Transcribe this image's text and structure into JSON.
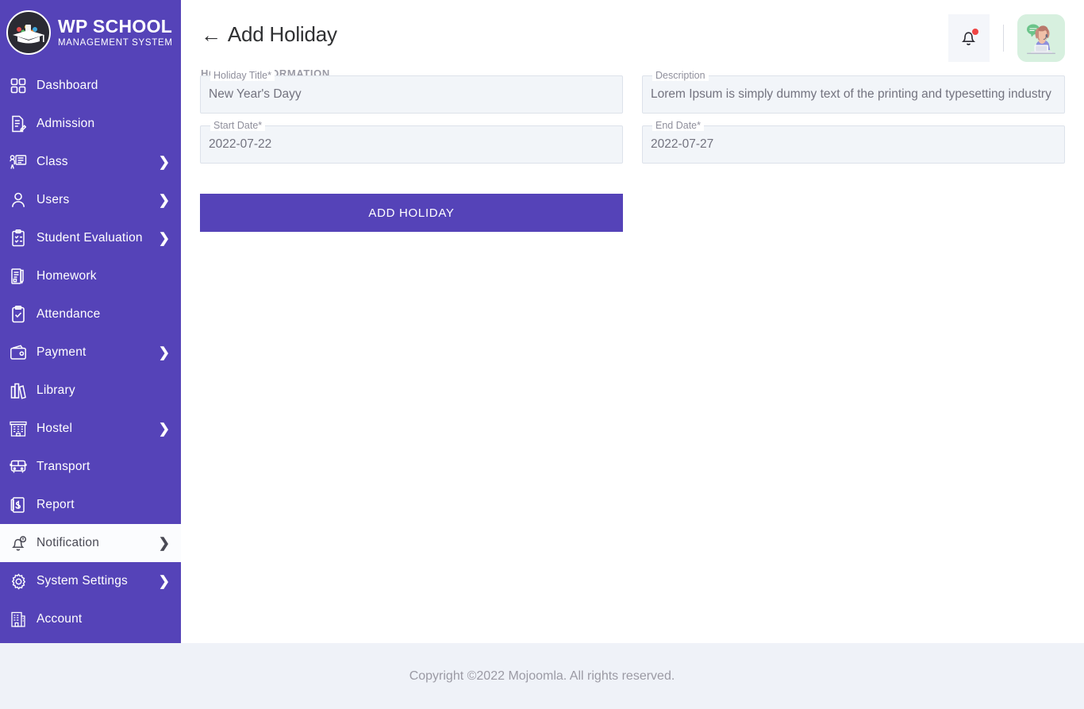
{
  "brand": {
    "title": "WP SCHOOL",
    "subtitle": "MANAGEMENT SYSTEM",
    "logo_icon": "graduation-cap-logo"
  },
  "sidebar": {
    "items": [
      {
        "label": "Dashboard",
        "icon": "grid-icon",
        "caret": "",
        "active": false
      },
      {
        "label": "Admission",
        "icon": "document-edit-icon",
        "caret": "",
        "active": false
      },
      {
        "label": "Class",
        "icon": "classroom-icon",
        "caret": "❯",
        "active": false
      },
      {
        "label": "Users",
        "icon": "user-icon",
        "caret": "❯",
        "active": false
      },
      {
        "label": "Student Evaluation",
        "icon": "clipboard-check-icon",
        "caret": "❯",
        "active": false
      },
      {
        "label": "Homework",
        "icon": "homework-icon",
        "caret": "",
        "active": false
      },
      {
        "label": "Attendance",
        "icon": "attendance-icon",
        "caret": "",
        "active": false
      },
      {
        "label": "Payment",
        "icon": "wallet-icon",
        "caret": "❯",
        "active": false
      },
      {
        "label": "Library",
        "icon": "books-icon",
        "caret": "",
        "active": false
      },
      {
        "label": "Hostel",
        "icon": "hostel-icon",
        "caret": "❯",
        "active": false
      },
      {
        "label": "Transport",
        "icon": "bus-icon",
        "caret": "",
        "active": false
      },
      {
        "label": "Report",
        "icon": "report-icon",
        "caret": "",
        "active": false
      },
      {
        "label": "Notification",
        "icon": "bell-icon",
        "caret": "❯",
        "active": true
      },
      {
        "label": "System Settings",
        "icon": "gear-icon",
        "caret": "❯",
        "active": false
      },
      {
        "label": "Account",
        "icon": "account-building-icon",
        "caret": "",
        "active": false
      }
    ]
  },
  "header": {
    "back_arrow": "←",
    "title": "Add Holiday",
    "section_label": "HOLIDAY INFORMATION",
    "bell_icon": "bell-icon",
    "has_notification_dot": true,
    "avatar_icon": "support-agent-avatar"
  },
  "form": {
    "fields": [
      {
        "label": "Holiday Title*",
        "value": "New Year's Dayy",
        "placeholder": ""
      },
      {
        "label": "Description",
        "value": "Lorem Ipsum is simply dummy text of the printing and typesetting industry",
        "placeholder": ""
      },
      {
        "label": "Start Date*",
        "value": "2022-07-22",
        "placeholder": ""
      },
      {
        "label": "End Date*",
        "value": "2022-07-27",
        "placeholder": ""
      }
    ],
    "submit_label": "ADD HOLIDAY"
  },
  "footer": {
    "text": "Copyright ©2022 Mojoomla. All rights reserved."
  },
  "colors": {
    "sidebar_purple": "#5543B8",
    "button_purple": "#5543B8",
    "field_bg": "#F2F5F9",
    "footer_bg": "#EFF2F8",
    "notification_dot": "#EF4444",
    "avatar_bg": "#D7F0DF"
  }
}
